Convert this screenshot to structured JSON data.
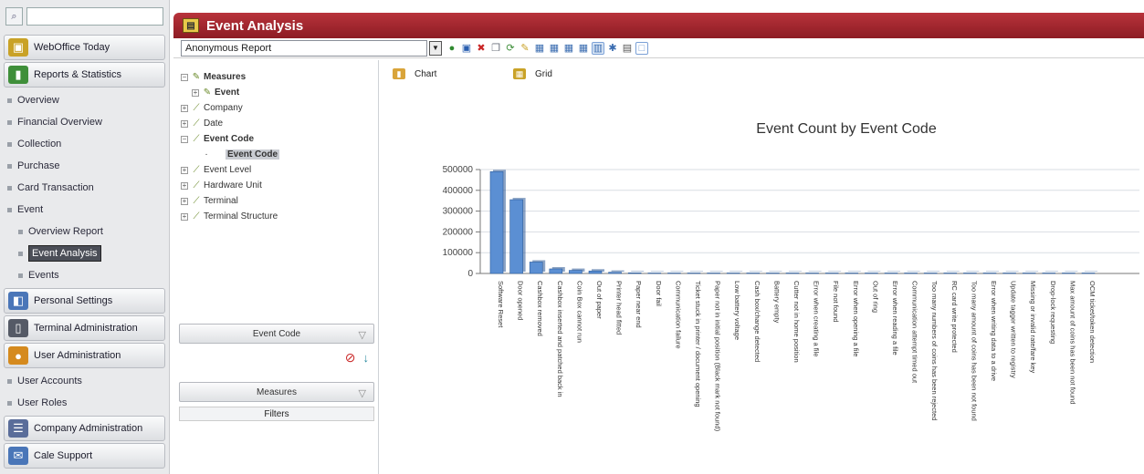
{
  "sidebar": {
    "search_value": "",
    "sections": [
      {
        "label": "WebOffice Today",
        "icon": "briefcase-icon",
        "color": "#c9a227"
      },
      {
        "label": "Reports & Statistics",
        "icon": "bar-chart-icon",
        "color": "#3f8f3a"
      }
    ],
    "report_items": [
      "Overview",
      "Financial Overview",
      "Collection",
      "Purchase",
      "Card Transaction",
      "Event"
    ],
    "event_items": [
      "Overview Report",
      "Event Analysis",
      "Events"
    ],
    "sections_bottom": [
      {
        "label": "Personal Settings",
        "icon": "user-settings-icon",
        "color": "#4a76b8"
      },
      {
        "label": "Terminal Administration",
        "icon": "terminal-icon",
        "color": "#555a66"
      },
      {
        "label": "User Administration",
        "icon": "users-icon",
        "color": "#d58a1e"
      }
    ],
    "user_items": [
      "User Accounts",
      "User Roles"
    ],
    "sections_last": [
      {
        "label": "Company Administration",
        "icon": "company-icon",
        "color": "#5a6d9a"
      },
      {
        "label": "Cale Support",
        "icon": "support-icon",
        "color": "#4a76b8"
      }
    ]
  },
  "header": {
    "title": "Event Analysis",
    "report_name": "Anonymous Report"
  },
  "tree": {
    "nodes": [
      {
        "label": "Measures",
        "level": 0,
        "expander": "−",
        "bold": true
      },
      {
        "label": "Event",
        "level": 1,
        "expander": "+",
        "bold": true
      },
      {
        "label": "Company",
        "level": 0,
        "expander": "+",
        "bold": false
      },
      {
        "label": "Date",
        "level": 0,
        "expander": "+",
        "bold": false
      },
      {
        "label": "Event Code",
        "level": 0,
        "expander": "−",
        "bold": true
      },
      {
        "label": "Event Code",
        "level": 2,
        "expander": "",
        "bold": true,
        "selected": true
      },
      {
        "label": "Event Level",
        "level": 0,
        "expander": "+",
        "bold": false
      },
      {
        "label": "Hardware Unit",
        "level": 0,
        "expander": "+",
        "bold": false
      },
      {
        "label": "Terminal",
        "level": 0,
        "expander": "+",
        "bold": false
      },
      {
        "label": "Terminal Structure",
        "level": 0,
        "expander": "+",
        "bold": false
      }
    ],
    "rows_bar": "Event Code",
    "measures_bar": "Measures",
    "filters_bar": "Filters"
  },
  "views": {
    "chart_label": "Chart",
    "grid_label": "Grid"
  },
  "chart_data": {
    "type": "bar",
    "title": "Event Count by Event Code",
    "xlabel": "",
    "ylabel": "",
    "ylim": [
      0,
      500000
    ],
    "yticks": [
      "500000",
      "400000",
      "300000",
      "200000",
      "100000",
      "0"
    ],
    "grid": true,
    "bar_color": "#5b8fd3",
    "categories": [
      "Software Reset",
      "Door opened",
      "Cashbox removed",
      "Cashbox inserted and patched back in",
      "Coin Box cannot run",
      "Out of paper",
      "Printer head fitted",
      "Paper near end",
      "Door fail",
      "Communication failure",
      "Ticket stuck in printer / document opening",
      "Paper not in initial position (Black mark not found)",
      "Low battery voltage",
      "Cash box/change detected",
      "Battery empty",
      "Cutter not in home position",
      "Error when creating a file",
      "File not found",
      "Error when opening a file",
      "Out of ring",
      "Error when reading a file",
      "Communication attempt timed out",
      "Too many numbers of coins has been rejected",
      "RC card write protected",
      "Too many amount of coins has been not found",
      "Error when writing data to a drive",
      "Update tagger written to registry",
      "Missing or invalid rate/fare key",
      "Drop-lock requesting",
      "Max amount of coins has been not found",
      "OCM ticket/token detection"
    ],
    "values": [
      490000,
      355000,
      55000,
      22000,
      15000,
      12000,
      6000,
      3000,
      1500,
      900,
      700,
      500,
      400,
      300,
      250,
      200,
      180,
      160,
      150,
      140,
      130,
      120,
      110,
      100,
      90,
      80,
      70,
      60,
      50,
      40,
      30
    ]
  }
}
